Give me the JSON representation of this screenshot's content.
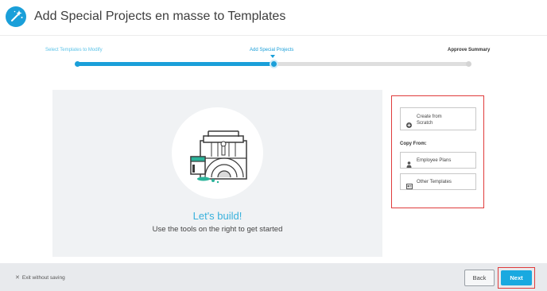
{
  "header": {
    "title": "Add Special Projects en masse to Templates",
    "icon": "magic-wand-icon"
  },
  "stepper": {
    "steps": [
      {
        "label": "Select Templates to Modify",
        "state": "done"
      },
      {
        "label": "Add Special Projects",
        "state": "current"
      },
      {
        "label": "Approve Summary",
        "state": "upcoming"
      }
    ],
    "progress_fraction": 0.5
  },
  "canvas": {
    "illustration": "toolbox-with-paint-can-illustration",
    "heading": "Let's build!",
    "subtext": "Use the tools on the right to get started"
  },
  "panel": {
    "create_label": "Create from Scratch",
    "copy_from_label": "Copy From:",
    "employee_plans_label": "Employee Plans",
    "other_templates_label": "Other Templates"
  },
  "footer": {
    "exit_label": "Exit without saving",
    "back_label": "Back",
    "next_label": "Next"
  },
  "colors": {
    "accent": "#1a9fd9",
    "highlight_border": "#e03c3c",
    "footer_bg": "#e8eaed",
    "canvas_bg": "#f0f2f4"
  }
}
